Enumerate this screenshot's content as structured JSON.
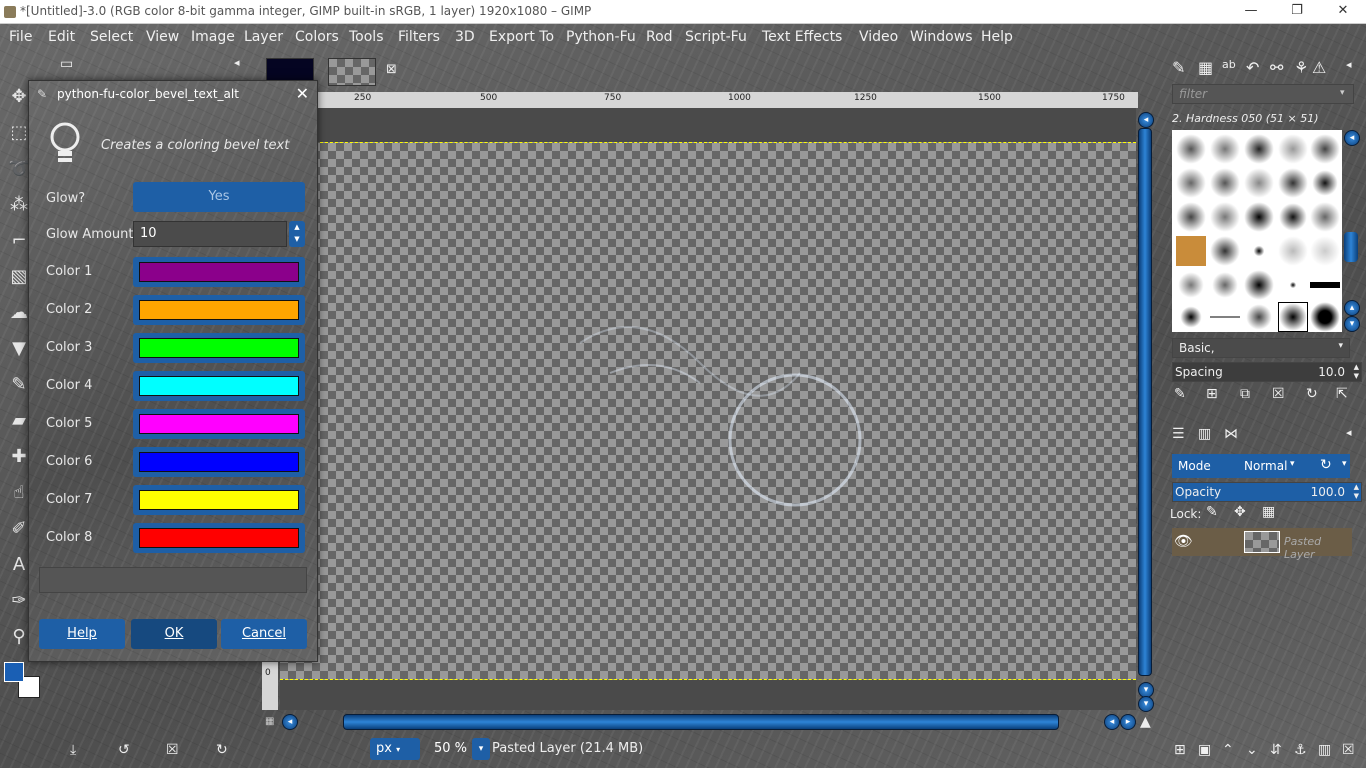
{
  "window": {
    "title": "*[Untitled]-3.0 (RGB color 8-bit gamma integer, GIMP built-in sRGB, 1 layer) 1920x1080 – GIMP",
    "minimize": "—",
    "maximize": "❐",
    "close": "✕"
  },
  "menu": [
    "File",
    "Edit",
    "Select",
    "View",
    "Image",
    "Layer",
    "Colors",
    "Tools",
    "Filters",
    "3D",
    "Export To",
    "Python-Fu",
    "Rod",
    "Script-Fu",
    "Text Effects",
    "Video",
    "Windows",
    "Help"
  ],
  "ruler": {
    "ticks": [
      "250",
      "500",
      "750",
      "1000",
      "1250",
      "1500",
      "1750"
    ]
  },
  "vruler": {
    "ticks": [
      "0"
    ]
  },
  "status": {
    "unit": "px",
    "zoom": "50 %",
    "message": "Pasted Layer (21.4 MB)"
  },
  "dialog": {
    "title": "python-fu-color_bevel_text_alt",
    "description": "Creates a coloring bevel text",
    "glow_label": "Glow?",
    "glow_value": "Yes",
    "glow_amount_label": "Glow Amount",
    "glow_amount_value": "10",
    "colors": [
      {
        "label": "Color 1",
        "hex": "#8B008B"
      },
      {
        "label": "Color 2",
        "hex": "#FFA500"
      },
      {
        "label": "Color 3",
        "hex": "#00FF00"
      },
      {
        "label": "Color 4",
        "hex": "#00FFFF"
      },
      {
        "label": "Color 5",
        "hex": "#FF00FF"
      },
      {
        "label": "Color 6",
        "hex": "#0000FF"
      },
      {
        "label": "Color 7",
        "hex": "#FFFF00"
      },
      {
        "label": "Color 8",
        "hex": "#FF0000"
      }
    ],
    "help_label": "Help",
    "ok_label": "OK",
    "cancel_label": "Cancel"
  },
  "brushes": {
    "filter_placeholder": "filter",
    "selected_name": "2. Hardness 050 (51 × 51)",
    "preset": "Basic,",
    "spacing_label": "Spacing",
    "spacing_value": "10.0"
  },
  "layers": {
    "mode_label": "Mode",
    "mode_value": "Normal",
    "opacity_label": "Opacity",
    "opacity_value": "100.0",
    "lock_label": "Lock:",
    "layer_name": "Pasted Layer"
  },
  "colors": {
    "fg": "#1a5fb4",
    "bg": "#ffffff",
    "accent": "#1e5fa6"
  }
}
